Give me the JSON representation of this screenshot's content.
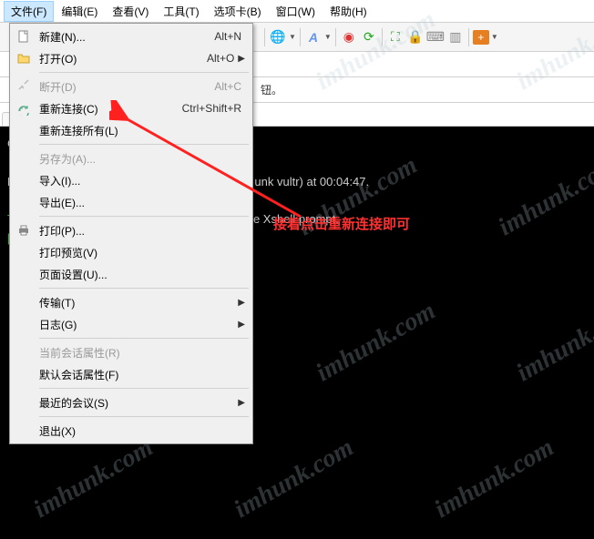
{
  "menubar": {
    "items": [
      {
        "label": "文件(F)",
        "active": true
      },
      {
        "label": "编辑(E)"
      },
      {
        "label": "查看(V)"
      },
      {
        "label": "工具(T)"
      },
      {
        "label": "选项卡(B)"
      },
      {
        "label": "窗口(W)"
      },
      {
        "label": "帮助(H)"
      }
    ]
  },
  "file_menu": {
    "groups": [
      [
        {
          "icon": "new",
          "label": "新建(N)...",
          "shortcut": "Alt+N"
        },
        {
          "icon": "open",
          "label": "打开(O)",
          "shortcut": "Alt+O",
          "arrow": true
        }
      ],
      [
        {
          "icon": "disconnect",
          "label": "断开(D)",
          "shortcut": "Alt+C",
          "disabled": true
        },
        {
          "icon": "reconnect",
          "label": "重新连接(C)",
          "shortcut": "Ctrl+Shift+R"
        },
        {
          "label": "重新连接所有(L)"
        }
      ],
      [
        {
          "label": "另存为(A)...",
          "disabled": true
        },
        {
          "label": "导入(I)..."
        },
        {
          "label": "导出(E)..."
        }
      ],
      [
        {
          "icon": "print",
          "label": "打印(P)..."
        },
        {
          "label": "打印预览(V)"
        },
        {
          "label": "页面设置(U)..."
        }
      ],
      [
        {
          "label": "传输(T)",
          "arrow": true
        },
        {
          "label": "日志(G)",
          "arrow": true
        }
      ],
      [
        {
          "label": "当前会话属性(R)",
          "disabled": true
        },
        {
          "label": "默认会话属性(F)"
        }
      ],
      [
        {
          "label": "最近的会议(S)",
          "arrow": true
        }
      ],
      [
        {
          "label": "退出(X)"
        }
      ]
    ]
  },
  "subbar_text": "钮。",
  "terminal": {
    "line1_prefix": "C",
    "line2_prefix": "D",
    "line2_text": "unk vultr) at 00:04:47.",
    "line3_prefix": "T",
    "line3_text": "e Xshell prompt.",
    "line4_prefix": "["
  },
  "annotation": "接着点击重新连接即可",
  "watermark": "imhunk.com"
}
